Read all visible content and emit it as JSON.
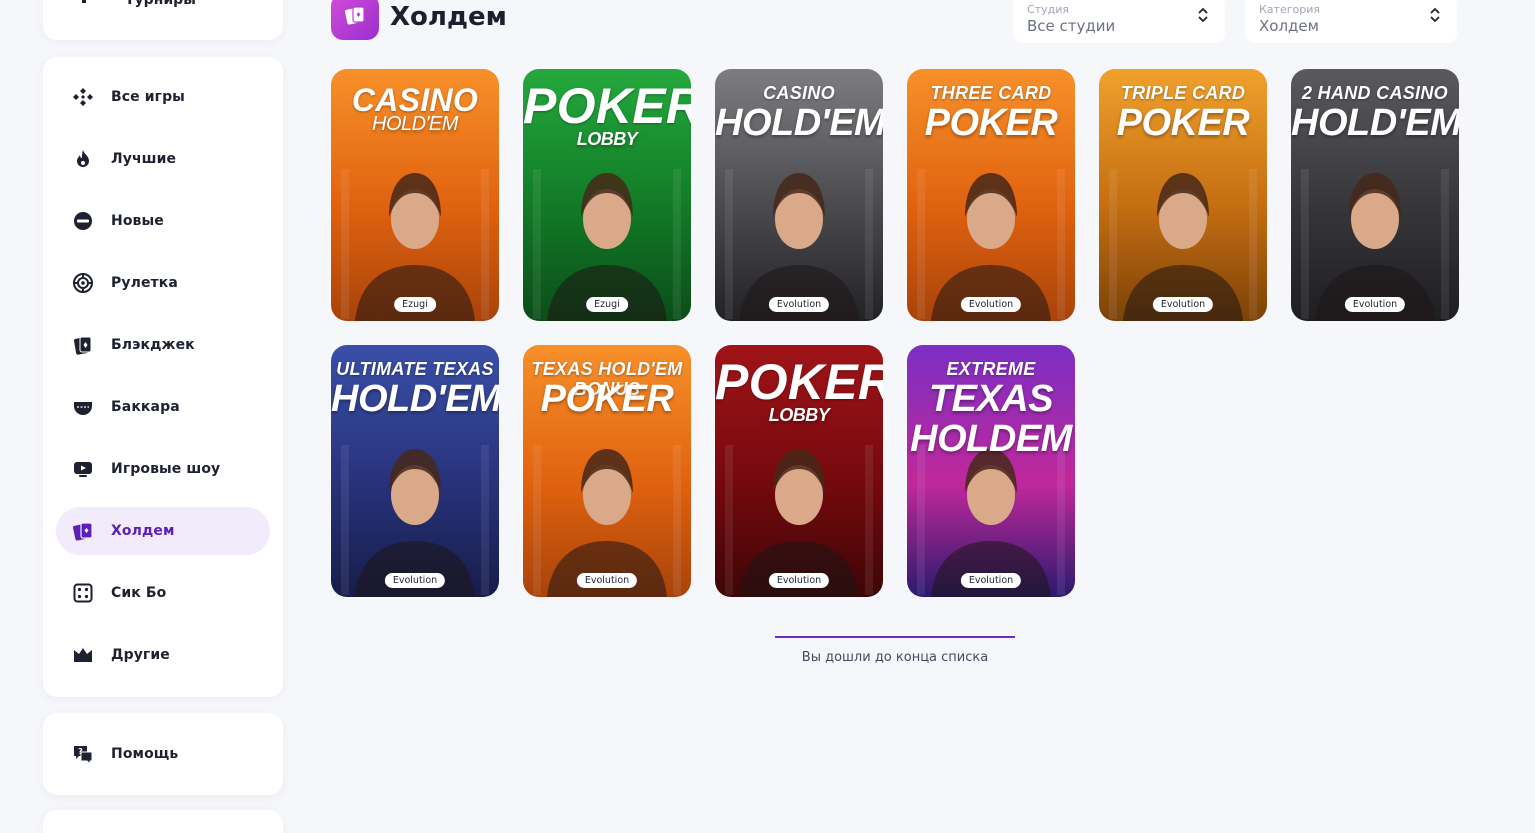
{
  "sidebar": {
    "top_item": {
      "label": "Турниры",
      "icon": "tournament-icon"
    },
    "items": [
      {
        "label": "Все игры",
        "icon": "all-games-icon"
      },
      {
        "label": "Лучшие",
        "icon": "fire-icon"
      },
      {
        "label": "Новые",
        "icon": "new-badge-icon"
      },
      {
        "label": "Рулетка",
        "icon": "roulette-icon"
      },
      {
        "label": "Блэкджек",
        "icon": "blackjack-cards-icon"
      },
      {
        "label": "Баккара",
        "icon": "baccarat-table-icon"
      },
      {
        "label": "Игровые шоу",
        "icon": "game-show-icon"
      },
      {
        "label": "Холдем",
        "icon": "holdem-cards-icon"
      },
      {
        "label": "Сик Бо",
        "icon": "dice-icon"
      },
      {
        "label": "Другие",
        "icon": "crown-icon"
      }
    ],
    "active_index": 7,
    "help": {
      "label": "Помощь",
      "icon": "help-chat-icon"
    }
  },
  "header": {
    "title": "Холдем",
    "category_icon": "holdem-cards-icon",
    "studio_select": {
      "label": "Студия",
      "value": "Все студии"
    },
    "category_select": {
      "label": "Категория",
      "value": "Холдем"
    }
  },
  "games": [
    {
      "line1": "CASINO",
      "line2": "HOLD'EM",
      "provider": "Ezugi",
      "theme": "orange",
      "style": "mid-first"
    },
    {
      "line1": "POKER",
      "line2": "LOBBY",
      "provider": "Ezugi",
      "theme": "green",
      "style": "big-first"
    },
    {
      "line1": "CASINO",
      "line2": "HOLD'EM",
      "provider": "Evolution",
      "theme": "dark",
      "style": "normal"
    },
    {
      "line1": "THREE CARD",
      "line2": "POKER",
      "provider": "Evolution",
      "theme": "orange",
      "style": "normal"
    },
    {
      "line1": "TRIPLE CARD",
      "line2": "POKER",
      "provider": "Evolution",
      "theme": "amber",
      "style": "normal"
    },
    {
      "line1": "2 HAND CASINO",
      "line2": "HOLD'EM",
      "provider": "Evolution",
      "theme": "charcoal",
      "style": "normal"
    },
    {
      "line1": "ULTIMATE TEXAS",
      "line2": "HOLD'EM",
      "provider": "Evolution",
      "theme": "blue",
      "style": "normal"
    },
    {
      "line1": "TEXAS HOLD'EM BONUS",
      "line2": "POKER",
      "provider": "Evolution",
      "theme": "orange",
      "style": "normal"
    },
    {
      "line1": "POKER",
      "line2": "LOBBY",
      "provider": "Evolution",
      "theme": "red",
      "style": "big-first"
    },
    {
      "line1": "EXTREME",
      "line2": "TEXAS HOLDEM",
      "provider": "Evolution",
      "theme": "purple",
      "style": "normal"
    }
  ],
  "theme_colors": {
    "orange": [
      "#f7902a",
      "#e0620f",
      "#a8430b"
    ],
    "green": [
      "#25a83d",
      "#127a27",
      "#0b4d18"
    ],
    "dark": [
      "#7d7d80",
      "#4a4a4e",
      "#222226"
    ],
    "amber": [
      "#f0a12c",
      "#c46d12",
      "#7b4208"
    ],
    "charcoal": [
      "#5a5a5e",
      "#36363a",
      "#1e1e22"
    ],
    "blue": [
      "#3a4fa8",
      "#28327a",
      "#161d4a"
    ],
    "red": [
      "#a01418",
      "#74090d",
      "#3e0507"
    ],
    "purple": [
      "#7b2fc4",
      "#c0289a",
      "#2a1a6e"
    ]
  },
  "accent_color": "#6b2bc4",
  "end_of_list": "Вы дошли до конца списка"
}
